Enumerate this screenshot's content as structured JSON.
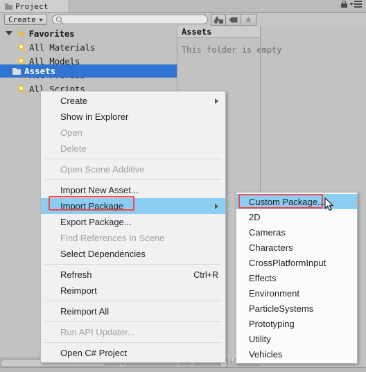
{
  "window": {
    "tab_label": "Project",
    "tab_icon": "folder-icon",
    "lock_icon": "lock-icon",
    "menu_icon": "hamburger-menu-icon"
  },
  "toolbar": {
    "create_label": "Create",
    "search_placeholder": "",
    "search_value": "",
    "search_icon": "search-icon",
    "filters": [
      {
        "name": "filter-by-type-button",
        "icon": "shapes-icon"
      },
      {
        "name": "filter-by-label-button",
        "icon": "tag-icon"
      },
      {
        "name": "filter-favorites-button",
        "icon": "star-icon"
      }
    ]
  },
  "tree": {
    "favorites": {
      "label": "Favorites",
      "icon": "star-icon",
      "expanded": true
    },
    "favorite_items": [
      {
        "label": "All Materials",
        "icon": "magnifier-icon"
      },
      {
        "label": "All Models",
        "icon": "magnifier-icon"
      },
      {
        "label": "All Prefabs",
        "icon": "magnifier-icon"
      },
      {
        "label": "All Scripts",
        "icon": "magnifier-icon"
      }
    ],
    "assets": {
      "label": "Assets",
      "icon": "folder-icon",
      "selected": true
    }
  },
  "assets_panel": {
    "header": "Assets",
    "empty_message": "This folder is empty"
  },
  "context_menu": {
    "items": [
      {
        "label": "Create",
        "enabled": true,
        "submenu": true,
        "shortcut": "",
        "highlighted": false,
        "boxed": false,
        "separator_after": false
      },
      {
        "label": "Show in Explorer",
        "enabled": true,
        "submenu": false,
        "shortcut": "",
        "highlighted": false,
        "boxed": false,
        "separator_after": false
      },
      {
        "label": "Open",
        "enabled": false,
        "submenu": false,
        "shortcut": "",
        "highlighted": false,
        "boxed": false,
        "separator_after": false
      },
      {
        "label": "Delete",
        "enabled": false,
        "submenu": false,
        "shortcut": "",
        "highlighted": false,
        "boxed": false,
        "separator_after": true
      },
      {
        "label": "Open Scene Additive",
        "enabled": false,
        "submenu": false,
        "shortcut": "",
        "highlighted": false,
        "boxed": false,
        "separator_after": true
      },
      {
        "label": "Import New Asset...",
        "enabled": true,
        "submenu": false,
        "shortcut": "",
        "highlighted": false,
        "boxed": false,
        "separator_after": false
      },
      {
        "label": "Import Package",
        "enabled": true,
        "submenu": true,
        "shortcut": "",
        "highlighted": true,
        "boxed": true,
        "separator_after": false
      },
      {
        "label": "Export Package...",
        "enabled": true,
        "submenu": false,
        "shortcut": "",
        "highlighted": false,
        "boxed": false,
        "separator_after": false
      },
      {
        "label": "Find References In Scene",
        "enabled": false,
        "submenu": false,
        "shortcut": "",
        "highlighted": false,
        "boxed": false,
        "separator_after": false
      },
      {
        "label": "Select Dependencies",
        "enabled": true,
        "submenu": false,
        "shortcut": "",
        "highlighted": false,
        "boxed": false,
        "separator_after": true
      },
      {
        "label": "Refresh",
        "enabled": true,
        "submenu": false,
        "shortcut": "Ctrl+R",
        "highlighted": false,
        "boxed": false,
        "separator_after": false
      },
      {
        "label": "Reimport",
        "enabled": true,
        "submenu": false,
        "shortcut": "",
        "highlighted": false,
        "boxed": false,
        "separator_after": true
      },
      {
        "label": "Reimport All",
        "enabled": true,
        "submenu": false,
        "shortcut": "",
        "highlighted": false,
        "boxed": false,
        "separator_after": true
      },
      {
        "label": "Run API Updater...",
        "enabled": false,
        "submenu": false,
        "shortcut": "",
        "highlighted": false,
        "boxed": false,
        "separator_after": true
      },
      {
        "label": "Open C# Project",
        "enabled": true,
        "submenu": false,
        "shortcut": "",
        "highlighted": false,
        "boxed": false,
        "separator_after": false
      }
    ]
  },
  "submenu": {
    "items": [
      {
        "label": "Custom Package...",
        "highlighted": true,
        "boxed": true
      },
      {
        "label": "2D",
        "highlighted": false,
        "boxed": false
      },
      {
        "label": "Cameras",
        "highlighted": false,
        "boxed": false
      },
      {
        "label": "Characters",
        "highlighted": false,
        "boxed": false
      },
      {
        "label": "CrossPlatformInput",
        "highlighted": false,
        "boxed": false
      },
      {
        "label": "Effects",
        "highlighted": false,
        "boxed": false
      },
      {
        "label": "Environment",
        "highlighted": false,
        "boxed": false
      },
      {
        "label": "ParticleSystems",
        "highlighted": false,
        "boxed": false
      },
      {
        "label": "Prototyping",
        "highlighted": false,
        "boxed": false
      },
      {
        "label": "Utility",
        "highlighted": false,
        "boxed": false
      },
      {
        "label": "Vehicles",
        "highlighted": false,
        "boxed": false
      }
    ]
  },
  "watermark": "http://blog.csdn.net/yurichou",
  "colors": {
    "selection_blue": "#2f74d0",
    "menu_highlight": "#8ecdf2",
    "annotation_red": "#f04a4a",
    "panel_gray": "#c2c2c2",
    "menu_bg": "#f1f1f1",
    "star_yellow": "#f2c230"
  }
}
